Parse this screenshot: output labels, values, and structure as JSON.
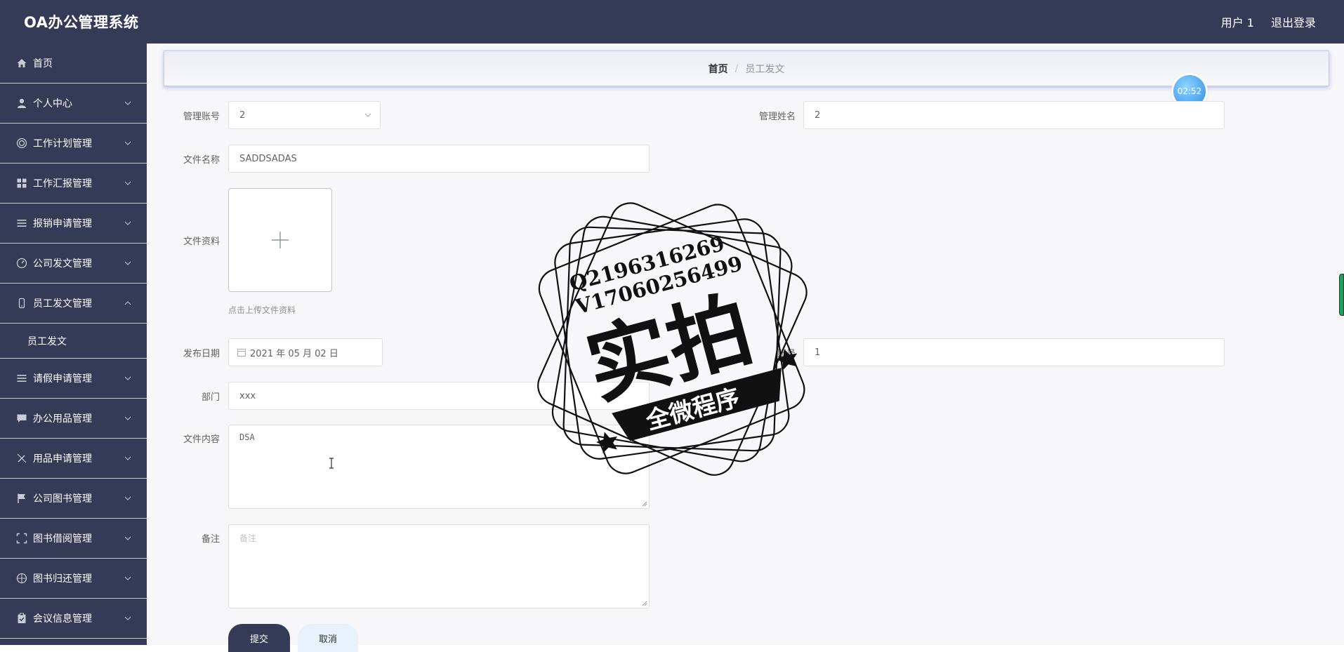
{
  "app": {
    "title": "OA办公管理系统"
  },
  "header": {
    "user": "用户 1",
    "logout": "退出登录"
  },
  "sidebar": {
    "items": [
      {
        "label": "首页",
        "icon": "home-icon"
      },
      {
        "label": "个人中心",
        "icon": "user-icon"
      },
      {
        "label": "工作计划管理",
        "icon": "target-icon"
      },
      {
        "label": "工作汇报管理",
        "icon": "grid-icon"
      },
      {
        "label": "报销申请管理",
        "icon": "list-icon"
      },
      {
        "label": "公司发文管理",
        "icon": "gauge-icon"
      },
      {
        "label": "员工发文管理",
        "icon": "phone-icon"
      },
      {
        "label": "员工发文",
        "icon": ""
      },
      {
        "label": "请假申请管理",
        "icon": "list-icon"
      },
      {
        "label": "办公用品管理",
        "icon": "chat-icon"
      },
      {
        "label": "用品申请管理",
        "icon": "no-edit-icon"
      },
      {
        "label": "公司图书管理",
        "icon": "flag-icon"
      },
      {
        "label": "图书借阅管理",
        "icon": "full-screen-icon"
      },
      {
        "label": "图书归还管理",
        "icon": "compass-icon"
      },
      {
        "label": "会议信息管理",
        "icon": "clipboard-icon"
      }
    ]
  },
  "breadcrumb": {
    "home": "首页",
    "separator": "/",
    "current": "员工发文"
  },
  "timer": "02:52",
  "form": {
    "admin_account_label": "管理账号",
    "admin_account_value": "2",
    "admin_name_label": "管理姓名",
    "admin_name_value": "2",
    "file_name_label": "文件名称",
    "file_name_value": "SADDSADAS",
    "file_material_label": "文件资料",
    "upload_plus": "+",
    "upload_hint": "点击上传文件资料",
    "publish_date_label": "发布日期",
    "publish_date_value": "2021 年 05 月 02 日",
    "account_label": "账号",
    "account_value": "1",
    "department_label": "部门",
    "department_value": "xxx",
    "content_label": "文件内容",
    "content_value": "DSA",
    "remark_label": "备注",
    "remark_placeholder": "备注",
    "submit": "提交",
    "cancel": "取消"
  },
  "watermark": {
    "line1": "Q2196316269",
    "line2": "V17060256499",
    "main": "实拍",
    "ribbon": "全微程序"
  },
  "colors": {
    "sidebar": "#353a57",
    "topbar": "#353a57",
    "accent": "#2a8fe6"
  }
}
